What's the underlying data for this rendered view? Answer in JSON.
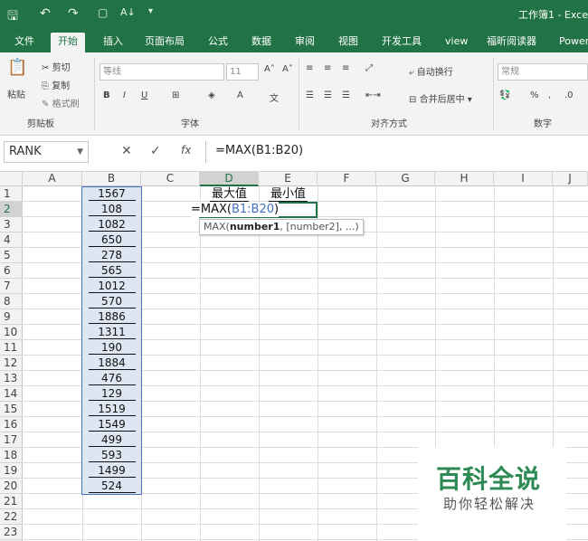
{
  "titlebar": {
    "save_icon": "save-icon",
    "undo_icon": "undo-icon",
    "redo_icon": "redo-icon",
    "title": "工作簿1 - Exce"
  },
  "tabs": [
    "文件",
    "开始",
    "插入",
    "页面布局",
    "公式",
    "数据",
    "审阅",
    "视图",
    "开发工具",
    "view",
    "福昕阅读器",
    "Power"
  ],
  "ribbon": {
    "clipboard": {
      "paste": "粘贴",
      "cut": "剪切",
      "copy": "复制",
      "format_painter": "格式刷",
      "group_label": "剪贴板"
    },
    "font": {
      "name": "等线",
      "size": "11",
      "bold": "B",
      "italic": "I",
      "underline": "U",
      "group_label": "字体"
    },
    "alignment": {
      "wrap": "自动换行",
      "merge": "合并后居中",
      "group_label": "对齐方式"
    },
    "number": {
      "format": "常规",
      "percent": "%",
      "comma": ",",
      "group_label": "数字"
    }
  },
  "formula_bar": {
    "name_box": "RANK",
    "cancel": "✕",
    "enter": "✓",
    "fx": "fx",
    "formula": "=MAX(B1:B20)"
  },
  "columns": [
    "A",
    "B",
    "C",
    "D",
    "E",
    "F",
    "G",
    "H",
    "I",
    "J"
  ],
  "rows": [
    "1",
    "2",
    "3",
    "4",
    "5",
    "6",
    "7",
    "8",
    "9",
    "10",
    "11",
    "12",
    "13",
    "14",
    "15",
    "16",
    "17",
    "18",
    "19",
    "20",
    "21",
    "22",
    "23"
  ],
  "cells": {
    "B": [
      "1567",
      "108",
      "1082",
      "650",
      "278",
      "565",
      "1012",
      "570",
      "1886",
      "1311",
      "190",
      "1884",
      "476",
      "129",
      "1519",
      "1549",
      "499",
      "593",
      "1499",
      "524"
    ],
    "D1": "最大值",
    "E1": "最小值",
    "edit_prefix": "=MAX(",
    "edit_ref": "B1:B20",
    "edit_suffix": ")"
  },
  "tooltip": {
    "prefix": "MAX(",
    "arg": "number1",
    "rest": ", [number2], ...)"
  },
  "watermark": {
    "title": "百科全说",
    "subtitle": "助你轻松解决"
  },
  "colors": {
    "excel_green": "#217346",
    "range_blue": "#4472c4",
    "selection_fill": "#dde6f2"
  }
}
